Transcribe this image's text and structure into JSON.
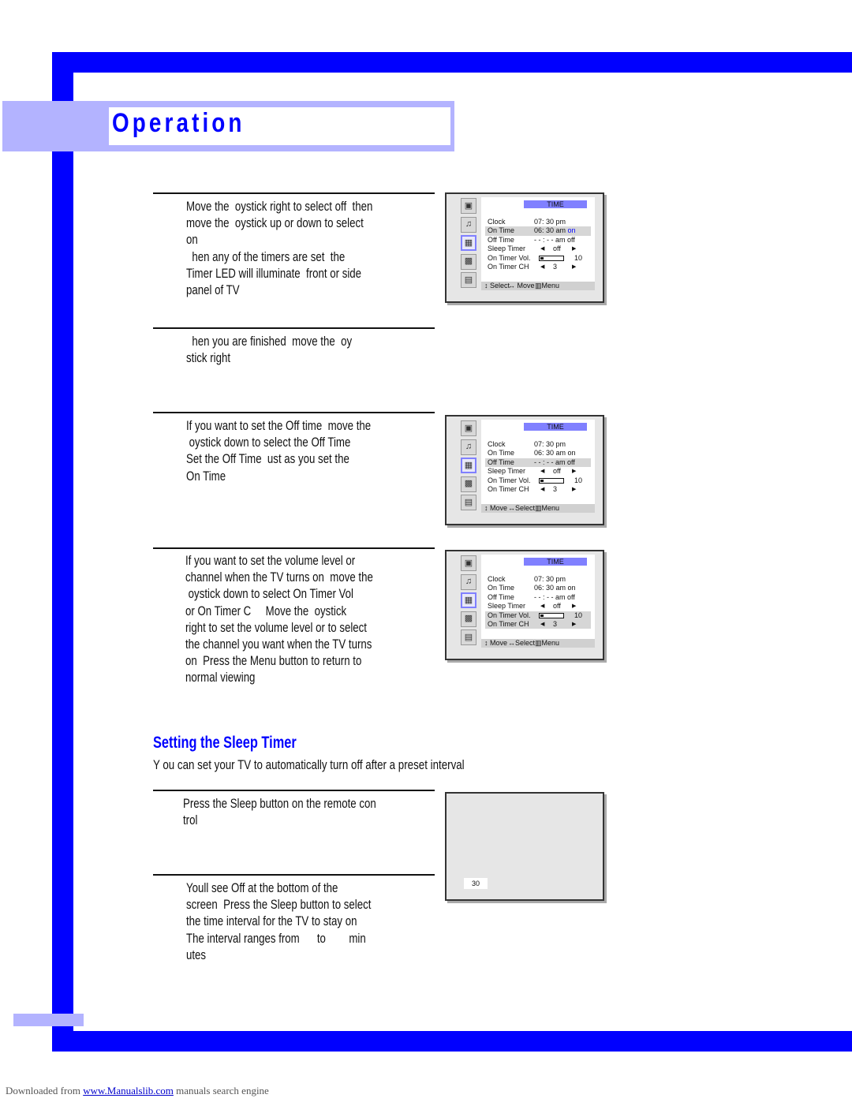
{
  "header": {
    "title": "Operation"
  },
  "colors": {
    "brand_blue": "#0000ff",
    "light_blue": "#b3b3ff",
    "menu_title_bar": "#8080ff"
  },
  "steps": [
    {
      "lines": [
        "Move the  oystick right to select off  then",
        "move the  oystick up or down to select",
        "on",
        "  hen any of the timers are set  the",
        "Timer LED will illuminate  front or side",
        "panel of TV"
      ]
    },
    {
      "lines": [
        "  hen you are finished  move the  oy",
        "stick right"
      ]
    },
    {
      "lines": [
        "If you want to set the Off time  move the",
        " oystick down to select the Off Time",
        "Set the Off Time  ust as you set the",
        "On Time"
      ]
    },
    {
      "lines": [
        "If you want to set the volume level or",
        "channel when the TV turns on  move the",
        " oystick down to select On Timer Vol",
        "or On Timer C     Move the  oystick",
        "right to set the volume level or to select",
        "the channel you want when the TV turns",
        "on  Press the Menu button to return to",
        "normal viewing"
      ]
    },
    {
      "lines": [
        "Press the Sleep button on the remote con",
        "trol"
      ]
    },
    {
      "lines": [
        "Youll see Off at the bottom of the",
        "screen  Press the Sleep button to select",
        "the time interval for the TV to stay on",
        "The interval ranges from      to        min",
        "utes"
      ]
    }
  ],
  "section": {
    "title": "Setting the Sleep Timer",
    "intro": "Y ou can set your TV to automatically turn off after a preset interval"
  },
  "tv_menu": {
    "title": "TIME",
    "sidebar_icons": [
      "picture-icon",
      "sound-icon",
      "timer-icon",
      "pip-icon",
      "setup-icon"
    ],
    "rows": [
      {
        "label": "Clock",
        "value": "07: 30 pm"
      },
      {
        "label": "On Time",
        "value": "06: 30 am",
        "state": "on"
      },
      {
        "label": "Off Time",
        "value": "- - : - - am",
        "state": "off"
      },
      {
        "label": "Sleep Timer",
        "value": "off"
      },
      {
        "label": "On Timer Vol.",
        "value": "10",
        "level": 0.1
      },
      {
        "label": "On Timer CH",
        "value": "3"
      }
    ],
    "screens": [
      {
        "highlight": [
          "On Time"
        ],
        "footer": [
          "↕ Select",
          "↔ Move",
          "▥Menu"
        ]
      },
      {
        "highlight": [
          "Off Time"
        ],
        "footer": [
          "↕ Move",
          "↔Select",
          "▥Menu"
        ]
      },
      {
        "highlight": [
          "On Timer Vol.",
          "On Timer CH"
        ],
        "footer": [
          "↕ Move",
          "↔Select",
          "▥Menu"
        ]
      }
    ]
  },
  "sleep_screen": {
    "value": "30"
  },
  "footer": {
    "prefix": "Downloaded from ",
    "link": "www.Manualslib.com",
    "suffix": "  manuals search engine"
  }
}
